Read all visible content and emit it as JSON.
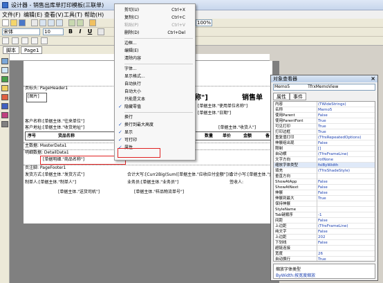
{
  "window": {
    "title": "设计器 - 销售出库单打印模板(三联单)"
  },
  "menu": [
    "文件(F)",
    "编辑(E)",
    "查看(V)",
    "工具(T)",
    "帮助(H)"
  ],
  "toolbar": {
    "font_name": "宋体",
    "font_size": "10",
    "bold": "B",
    "italic": "I",
    "underline": "U",
    "zoom": "100%"
  },
  "tabs": [
    "脚本",
    "Page1"
  ],
  "context_menu": {
    "items": [
      {
        "label": "剪切(U)",
        "shortcut": "Ctrl+X",
        "enabled": true
      },
      {
        "label": "复制(C)",
        "shortcut": "Ctrl+C",
        "enabled": true
      },
      {
        "label": "粘贴(P)",
        "shortcut": "Ctrl+V",
        "enabled": false
      },
      {
        "label": "删除(D)",
        "shortcut": "Ctrl+Del",
        "enabled": true
      },
      {
        "label": "边框...",
        "shortcut": "",
        "enabled": true
      },
      {
        "label": "编辑(E)",
        "shortcut": "",
        "enabled": true
      },
      {
        "label": "清除内容",
        "shortcut": "",
        "enabled": true
      },
      {
        "label": "字体...",
        "shortcut": "",
        "enabled": true
      },
      {
        "label": "显示格式...",
        "shortcut": "",
        "enabled": true
      },
      {
        "label": "自动执行",
        "shortcut": "",
        "enabled": true
      },
      {
        "label": "自动大小",
        "shortcut": "",
        "enabled": true
      },
      {
        "label": "只能是文本",
        "shortcut": "",
        "enabled": true
      },
      {
        "label": "隐藏零值",
        "shortcut": "",
        "enabled": true,
        "checked": true
      },
      {
        "label": "换行",
        "shortcut": "",
        "enabled": true
      },
      {
        "label": "换行到最大高度",
        "shortcut": "",
        "enabled": true,
        "checked": true
      },
      {
        "label": "显示",
        "shortcut": "",
        "enabled": true,
        "checked": true
      },
      {
        "label": "可打印",
        "shortcut": "",
        "enabled": true,
        "checked": true
      },
      {
        "label": "属性...",
        "shortcut": "",
        "enabled": true,
        "checked": true
      }
    ]
  },
  "report": {
    "page_header": "页标头: PageHeader1",
    "image_label": "[图片]",
    "title_name": "名称\"]",
    "title_sales": "销售单",
    "unit_line": "[单据主体.\"使用单位名称\"]",
    "customer_name": "客户名称:[单据主体.\"往来单位\"]",
    "customer_addr": "客户地址:[单据主体.\"收货地址\"]",
    "date_line": "[单据主体.\"日期\"]",
    "pay_line": "[单据主体.\"收货人\"]",
    "col_seq": "序号",
    "col_goods": "货品名称",
    "col_qty": "数量",
    "col_price": "单价",
    "col_amount": "金额",
    "col_note": "备",
    "master_band": "主数据: MasterData1",
    "detail_band": "明细数据: DetailData1",
    "detail_line": "[单据明细.\"商品名称\"]",
    "footer_band": "页注脚: PageFooter1",
    "footer_pay": "发货方式:[单据主体.\"发货方式\"]",
    "footer_total": "合计大写:[Curr2Big(Sum([单据主体.\"应收应付金额\"]))]",
    "footer_small": "合计小写:[单据主体.\"金额\"]",
    "footer_maker": "制单人:[单据主体.\"制单人\"]",
    "footer_clerk": "业务员:[单据主体.\"业务员\"]",
    "footer_recv": "签收人:",
    "footer_send": "[单据主体.\"送货司机\"]",
    "footer_logistics": "[单据主体.\"样品物流单号\"]"
  },
  "inspector": {
    "title": "对象查看器",
    "object": "Memo5",
    "object_type": "TfrxMemoView",
    "tabs": [
      "属性",
      "事件"
    ],
    "rows": [
      {
        "k": "内容",
        "v": "(TWideStrings)"
      },
      {
        "k": "名称",
        "v": "Memo5"
      },
      {
        "k": "使用Parent",
        "v": "False"
      },
      {
        "k": "使用ParentFont",
        "v": "True"
      },
      {
        "k": "可见打印",
        "v": "True"
      },
      {
        "k": "打印边框",
        "v": "True"
      },
      {
        "k": "重复值打印",
        "v": "(TfrxRepeatedOptions)"
      },
      {
        "k": "伸展组出现",
        "v": "False"
      },
      {
        "k": "限制",
        "v": "[]"
      },
      {
        "k": "自动横",
        "v": "(TfrxFrameLine)"
      },
      {
        "k": "文字方向",
        "v": "rotNone"
      },
      {
        "k": "缩放字体类型",
        "v": "fsiByWidth"
      },
      {
        "k": "填充",
        "v": "(TfrxShadeStyle)"
      },
      {
        "k": "垂直方向",
        "v": ""
      },
      {
        "k": "ShowAtApp",
        "v": "False"
      },
      {
        "k": "ShowAtNext",
        "v": "False"
      },
      {
        "k": "伸展",
        "v": "False"
      },
      {
        "k": "伸展到最大",
        "v": "True"
      },
      {
        "k": "保持伸展",
        "v": ""
      },
      {
        "k": "StyleName",
        "v": ""
      },
      {
        "k": "Tab键顺序",
        "v": "-1"
      },
      {
        "k": "间距",
        "v": "False"
      },
      {
        "k": "上边距",
        "v": "(TfrxFrameLine)"
      },
      {
        "k": "纯文字",
        "v": "False"
      },
      {
        "k": "上边距",
        "v": "202"
      },
      {
        "k": "下划线",
        "v": "False"
      },
      {
        "k": "超链连接",
        "v": ""
      },
      {
        "k": "宽度",
        "v": "26"
      },
      {
        "k": "自动换行",
        "v": "True"
      }
    ],
    "description_title": "缩放字体类型",
    "description_value": "ByWidth:按宽度缩放"
  }
}
